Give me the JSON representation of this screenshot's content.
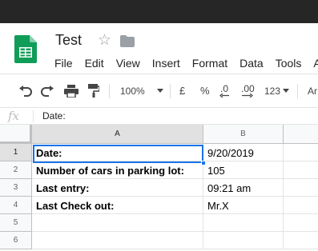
{
  "document": {
    "title": "Test"
  },
  "menu": [
    "File",
    "Edit",
    "View",
    "Insert",
    "Format",
    "Data",
    "Tools",
    "A"
  ],
  "toolbar": {
    "zoom": "100%",
    "currency": "£",
    "percent": "%",
    "decrease_decimals": ".0",
    "increase_decimals": ".00",
    "more_formats": "123",
    "font_partial": "Ar"
  },
  "formula_bar": {
    "fx": "fx",
    "content": "Date:"
  },
  "grid": {
    "columns": [
      "A",
      "B"
    ],
    "rows": [
      {
        "num": "1",
        "a": "Date:",
        "b": "9/20/2019"
      },
      {
        "num": "2",
        "a": "Number of cars in parking lot:",
        "b": "105"
      },
      {
        "num": "3",
        "a": "Last entry:",
        "b": "09:21 am"
      },
      {
        "num": "4",
        "a": "Last Check out:",
        "b": "Mr.X"
      },
      {
        "num": "5",
        "a": "",
        "b": ""
      },
      {
        "num": "6",
        "a": "",
        "b": ""
      }
    ],
    "selected_cell": "A1"
  },
  "colors": {
    "selection": "#1a73e8",
    "sheets_green": "#0f9d58",
    "top_bar": "#262626"
  }
}
